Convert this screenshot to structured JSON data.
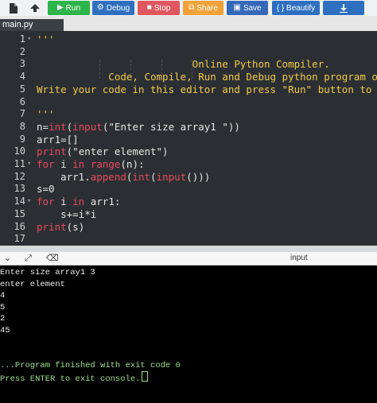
{
  "toolbar": {
    "file_icon": "file-icon",
    "upload_icon": "upload-icon",
    "run_label": "Run",
    "debug_label": "Debug",
    "stop_label": "Stop",
    "share_label": "Share",
    "save_label": "Save",
    "beautify_label": "{ } Beautify",
    "colors": {
      "run": "#2db44a",
      "debug": "#2e6fc0",
      "stop": "#e0575f",
      "share": "#f3a23a",
      "save": "#3468b8"
    }
  },
  "tab": {
    "label": "main.py"
  },
  "editor": {
    "lines": [
      {
        "n": "1",
        "fold": "▾",
        "html": "<span class='cmt'>'''</span>"
      },
      {
        "n": "2",
        "fold": "",
        "html": ""
      },
      {
        "n": "3",
        "fold": "",
        "html": "<span class='cmt'>                          Online Python Compiler.</span>"
      },
      {
        "n": "4",
        "fold": "",
        "html": "<span class='cmt'>            Code, Compile, Run and Debug python program online.</span>"
      },
      {
        "n": "5",
        "fold": "",
        "html": "<span class='cmt'>Write your code in this editor and press \"Run\" button to execute it.</span>"
      },
      {
        "n": "6",
        "fold": "",
        "html": ""
      },
      {
        "n": "7",
        "fold": "",
        "html": "<span class='cmt'>'''</span>"
      },
      {
        "n": "8",
        "fold": "",
        "html": "n=<span class='fn'>int</span>(<span class='fn'>input</span>(\"Enter size array1 \"))"
      },
      {
        "n": "9",
        "fold": "",
        "html": "arr1=[]"
      },
      {
        "n": "10",
        "fold": "",
        "html": "<span class='fn'>print</span>(\"enter element\")"
      },
      {
        "n": "11",
        "fold": "▾",
        "html": "<span class='kw'>for</span> i <span class='kw'>in</span> <span class='fn'>range</span>(n):"
      },
      {
        "n": "12",
        "fold": "",
        "html": "    arr1.<span class='fn'>append</span>(<span class='fn'>int</span>(<span class='fn'>input</span>()))"
      },
      {
        "n": "13",
        "fold": "",
        "html": "s=0"
      },
      {
        "n": "14",
        "fold": "▾",
        "html": "<span class='kw'>for</span> i <span class='kw'>in</span> arr1:"
      },
      {
        "n": "15",
        "fold": "",
        "html": "    s+=i*i"
      },
      {
        "n": "16",
        "fold": "",
        "html": "<span class='fn'>print</span>(s)"
      },
      {
        "n": "17",
        "fold": "",
        "html": ""
      }
    ]
  },
  "consolebar": {
    "collapse_icon": "chevron-down-icon",
    "expand_icon": "expand-icon",
    "clear_icon": "clear-icon",
    "input_label": "input"
  },
  "console": {
    "lines": [
      {
        "text": "Enter size array1 3",
        "color": "white"
      },
      {
        "text": "enter element",
        "color": "white"
      },
      {
        "text": "4",
        "color": "white"
      },
      {
        "text": "5",
        "color": "white"
      },
      {
        "text": "2",
        "color": "white"
      },
      {
        "text": "45",
        "color": "white"
      },
      {
        "text": "",
        "color": "white"
      },
      {
        "text": "",
        "color": "white"
      },
      {
        "text": "...Program finished with exit code 0",
        "color": "green"
      },
      {
        "text": "Press ENTER to exit console.",
        "color": "green",
        "cursor": true
      }
    ]
  }
}
